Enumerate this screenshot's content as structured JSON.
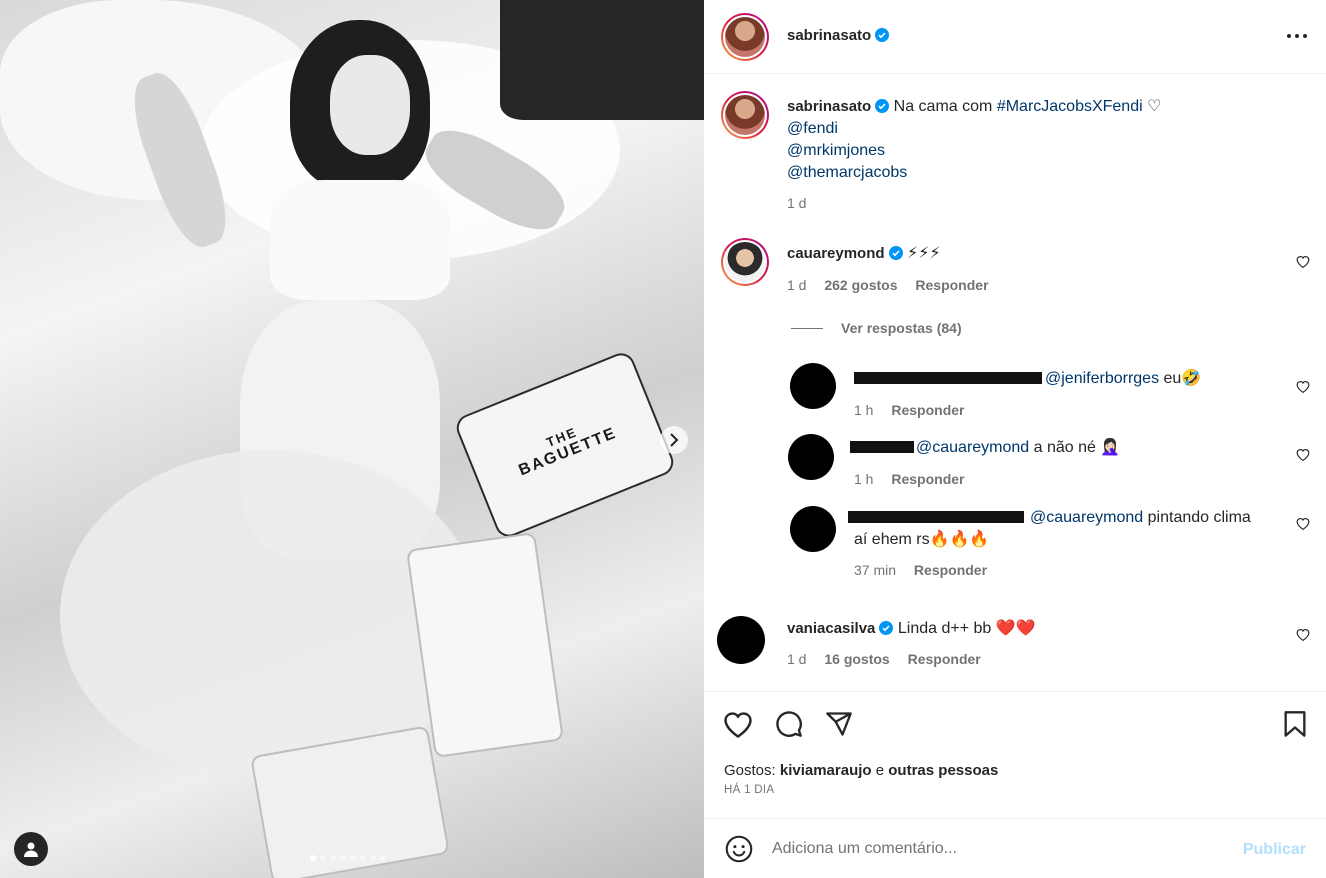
{
  "post": {
    "author": "sabrinasato",
    "caption_text": "Na cama com",
    "hashtag": "#MarcJacobsXFendi",
    "heart_emoji": "♡",
    "mentions": [
      "@fendi",
      "@mrkimjones",
      "@themarcjacobs"
    ],
    "time": "1 d",
    "bag_text_1": "THE",
    "bag_text_2": "BAGUETTE"
  },
  "comments": [
    {
      "user": "cauareymond",
      "text": "⚡⚡⚡",
      "time": "1 d",
      "likes": "262 gostos",
      "reply": "Responder",
      "view_replies": "Ver respostas (84)",
      "replies": [
        {
          "mention": "@jeniferborrges",
          "text": "eu🤣",
          "time": "1 h",
          "reply": "Responder"
        },
        {
          "mention": "@cauareymond",
          "text": "a não né 🤦🏻‍♀️",
          "time": "1 h",
          "reply": "Responder"
        },
        {
          "mention": "@cauareymond",
          "text": "pintando clima",
          "text2": "aí ehem rs🔥🔥🔥",
          "time": "37 min",
          "reply": "Responder"
        }
      ]
    },
    {
      "user": "vaniacasilva",
      "text": "Linda d++ bb ❤️❤️",
      "time": "1 d",
      "likes": "16 gostos",
      "reply": "Responder"
    }
  ],
  "likes_line": {
    "prefix": "Gostos:",
    "user": "kiviamaraujo",
    "connector": "e",
    "rest": "outras pessoas"
  },
  "date_label": "HÁ 1 DIA",
  "add_comment": {
    "placeholder": "Adiciona um comentário...",
    "publish": "Publicar"
  },
  "icons": [
    "heart-icon",
    "comment-icon",
    "share-icon",
    "bookmark-icon",
    "emoji-icon",
    "more-icon",
    "verified-icon",
    "chevron-right-icon",
    "user-tag-icon"
  ],
  "colors": {
    "verified": "#0095f6",
    "link": "#00376b",
    "publish_disabled": "#b2dffc"
  },
  "carousel": {
    "count": 8,
    "active_index": 0
  }
}
